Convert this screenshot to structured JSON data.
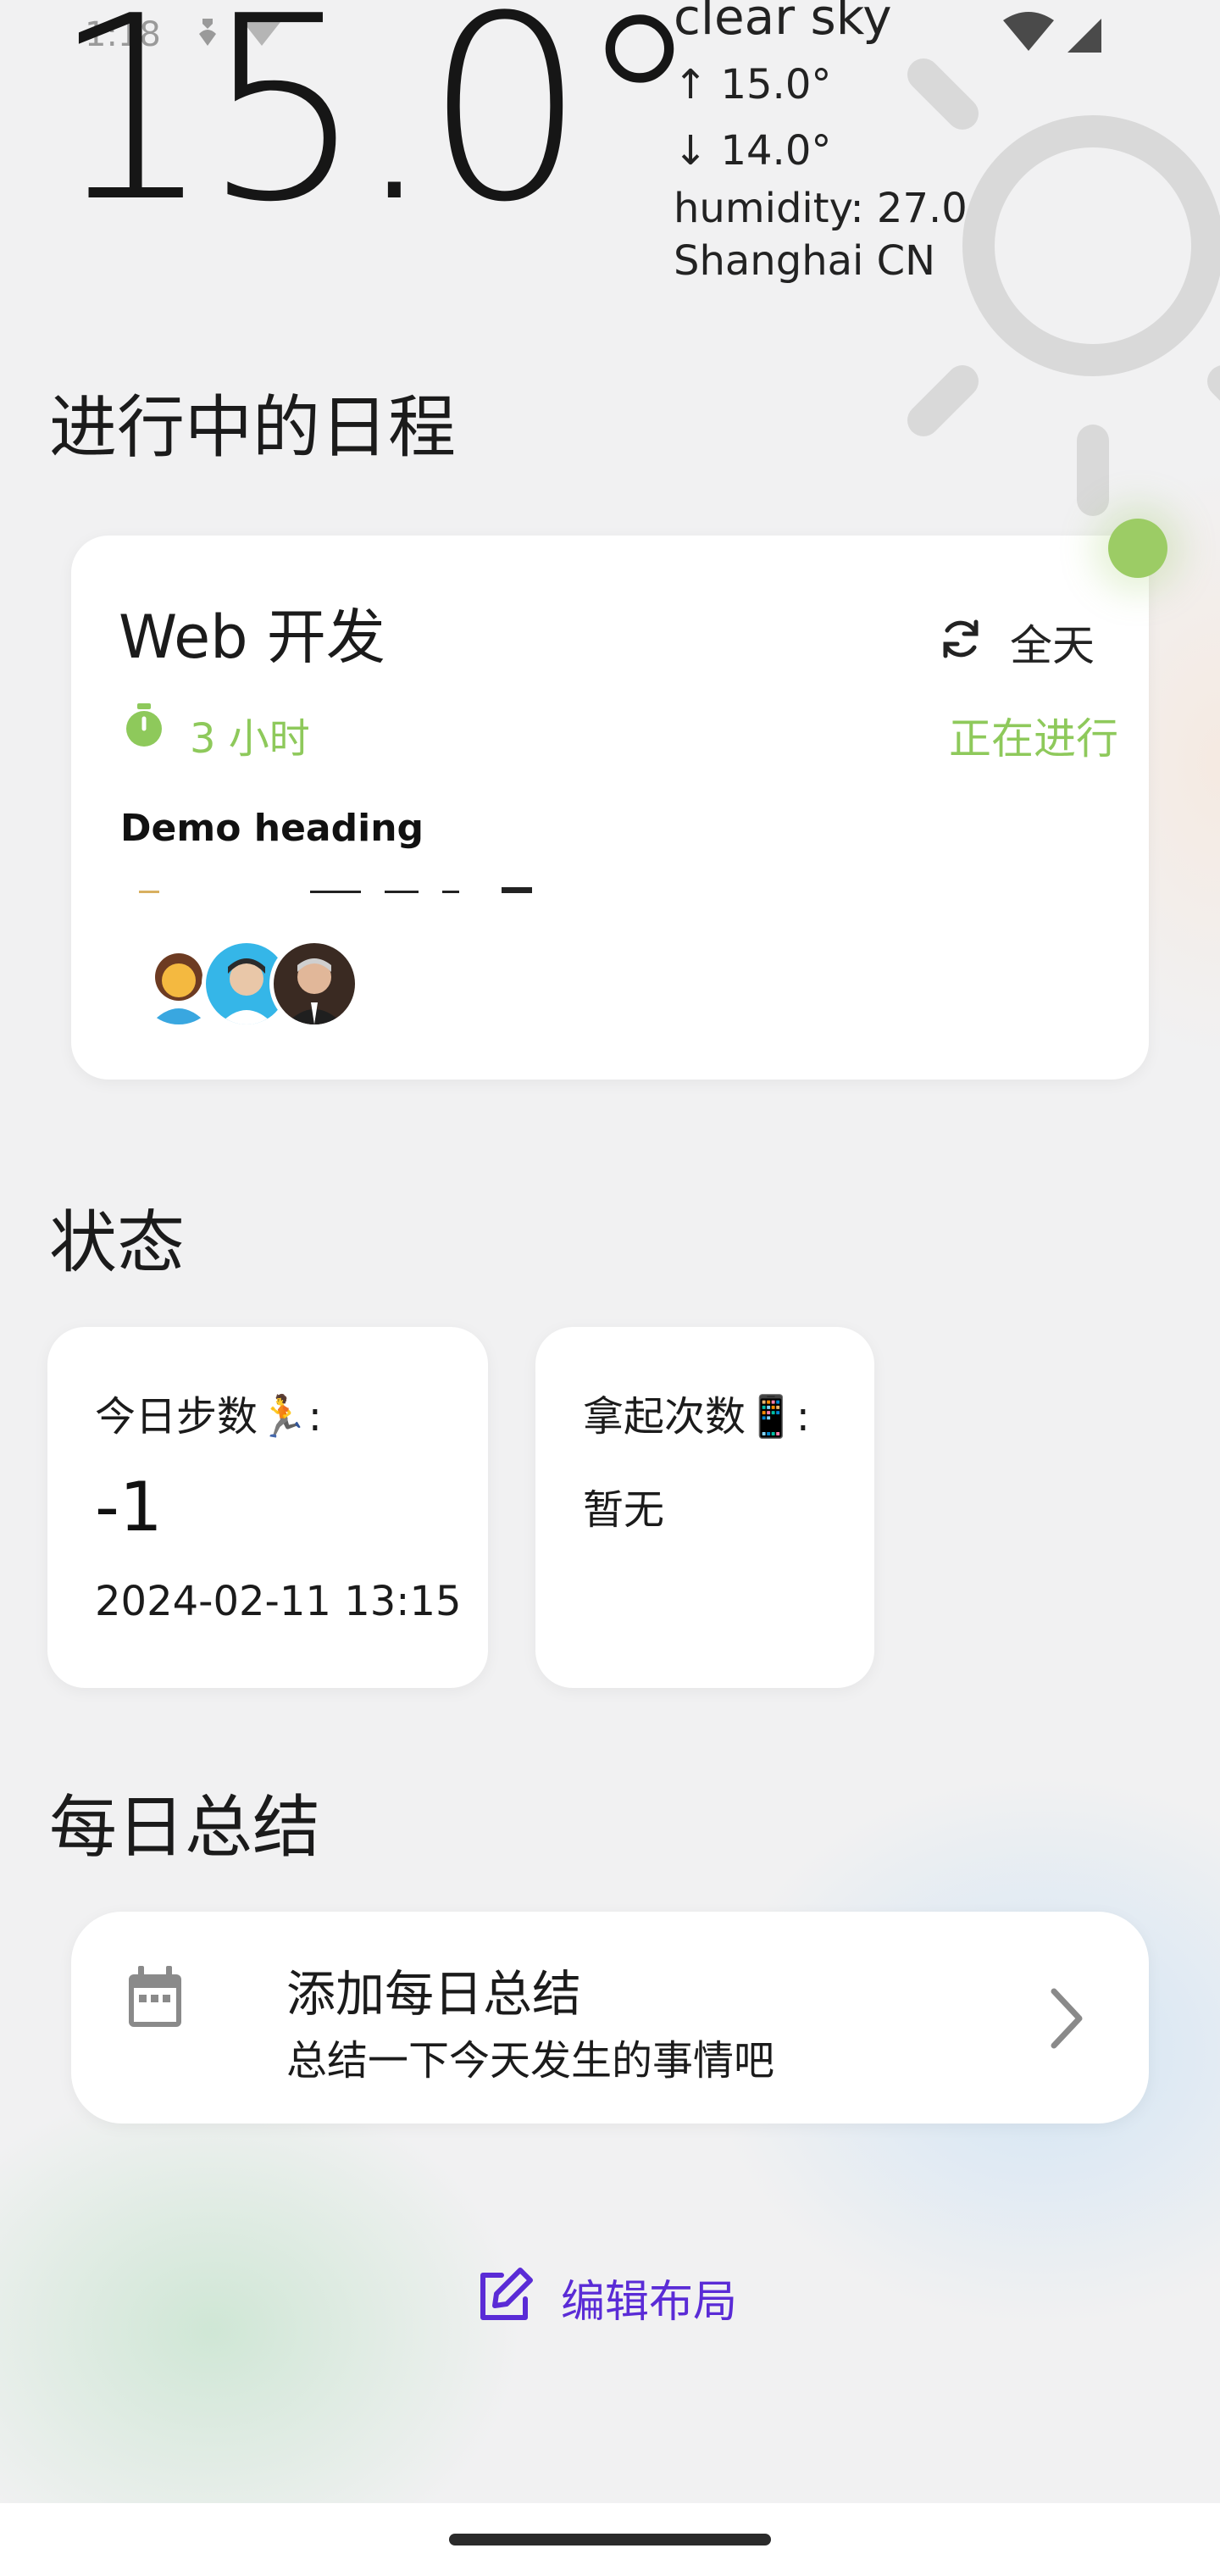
{
  "status_bar": {
    "time": "1:18",
    "icons": [
      "heart-status-icon",
      "wifi-question-icon",
      "wifi-icon",
      "signal-icon"
    ]
  },
  "weather": {
    "temperature": "15.0°",
    "description": "clear sky",
    "high": "↑ 15.0°",
    "low": "↓ 14.0°",
    "humidity": "humidity: 27.0",
    "location": "Shanghai CN",
    "icon": "sun-icon"
  },
  "schedule": {
    "section_title": "进行中的日程",
    "card": {
      "title": "Web 开发",
      "time_label": "全天",
      "duration": "3 小时",
      "status": "正在进行",
      "heading": "Demo heading",
      "status_color": "#8ec95b"
    }
  },
  "status": {
    "section_title": "状态",
    "steps": {
      "label": "今日步数🏃:",
      "value": "-1",
      "time": "2024-02-11 13:15"
    },
    "pickups": {
      "label": "拿起次数📱:",
      "value": "暂无"
    }
  },
  "summary": {
    "section_title": "每日总结",
    "title": "添加每日总结",
    "subtitle": "总结一下今天发生的事情吧"
  },
  "edit_layout": {
    "label": "编辑布局",
    "color": "#5a2bd6"
  }
}
